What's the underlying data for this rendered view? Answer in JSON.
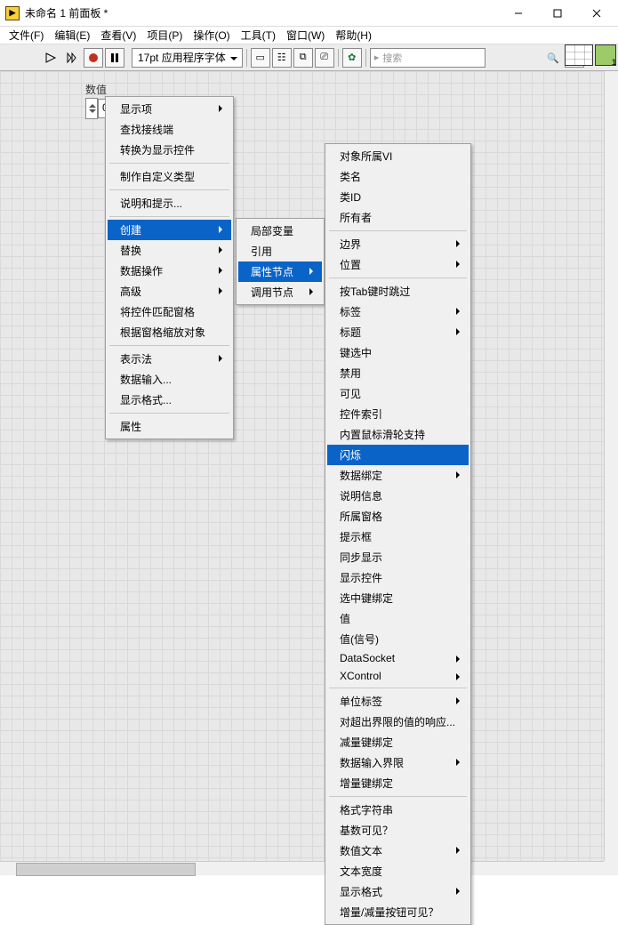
{
  "window": {
    "title": "未命名 1 前面板 *"
  },
  "menubar": [
    "文件(F)",
    "编辑(E)",
    "查看(V)",
    "项目(P)",
    "操作(O)",
    "工具(T)",
    "窗口(W)",
    "帮助(H)"
  ],
  "toolbar": {
    "font": "17pt 应用程序字体",
    "search_placeholder": "搜索"
  },
  "control": {
    "label": "数值",
    "value": "0"
  },
  "menu1": {
    "g1": [
      "显示项",
      "查找接线端",
      "转换为显示控件"
    ],
    "g2": [
      "制作自定义类型"
    ],
    "g3": [
      "说明和提示..."
    ],
    "g4": [
      "创建",
      "替换",
      "数据操作",
      "高级",
      "将控件匹配窗格",
      "根据窗格缩放对象"
    ],
    "g4_sub": [
      true,
      true,
      true,
      true,
      false,
      false
    ],
    "g4_hl": 0,
    "g5": [
      "表示法",
      "数据输入...",
      "显示格式..."
    ],
    "g5_sub": [
      true,
      false,
      false
    ],
    "g6": [
      "属性"
    ]
  },
  "menu2": {
    "items": [
      "局部变量",
      "引用",
      "属性节点",
      "调用节点"
    ],
    "sub": [
      false,
      false,
      true,
      true
    ],
    "hl": 2
  },
  "menu3": {
    "g1": [
      "对象所属VI",
      "类名",
      "类ID",
      "所有者"
    ],
    "g2": [
      "边界",
      "位置"
    ],
    "g2_sub": [
      true,
      true
    ],
    "g3": [
      "按Tab键时跳过",
      "标签",
      "标题",
      "键选中",
      "禁用",
      "可见",
      "控件索引",
      "内置鼠标滑轮支持",
      "闪烁",
      "数据绑定",
      "说明信息",
      "所属窗格",
      "提示框",
      "同步显示",
      "显示控件",
      "选中键绑定",
      "值",
      "值(信号)",
      "DataSocket",
      "XControl"
    ],
    "g3_sub": [
      false,
      true,
      true,
      false,
      false,
      false,
      false,
      false,
      false,
      true,
      false,
      false,
      false,
      false,
      false,
      false,
      false,
      false,
      true,
      true
    ],
    "g3_hl": 8,
    "g4": [
      "单位标签",
      "对超出界限的值的响应...",
      "减量键绑定",
      "数据输入界限",
      "增量键绑定"
    ],
    "g4_sub": [
      true,
      false,
      false,
      true,
      false
    ],
    "g5": [
      "格式字符串",
      "基数可见？",
      "数值文本",
      "文本宽度",
      "显示格式",
      "增量/减量按钮可见？"
    ],
    "g5_sub": [
      false,
      false,
      true,
      false,
      true,
      false
    ]
  }
}
